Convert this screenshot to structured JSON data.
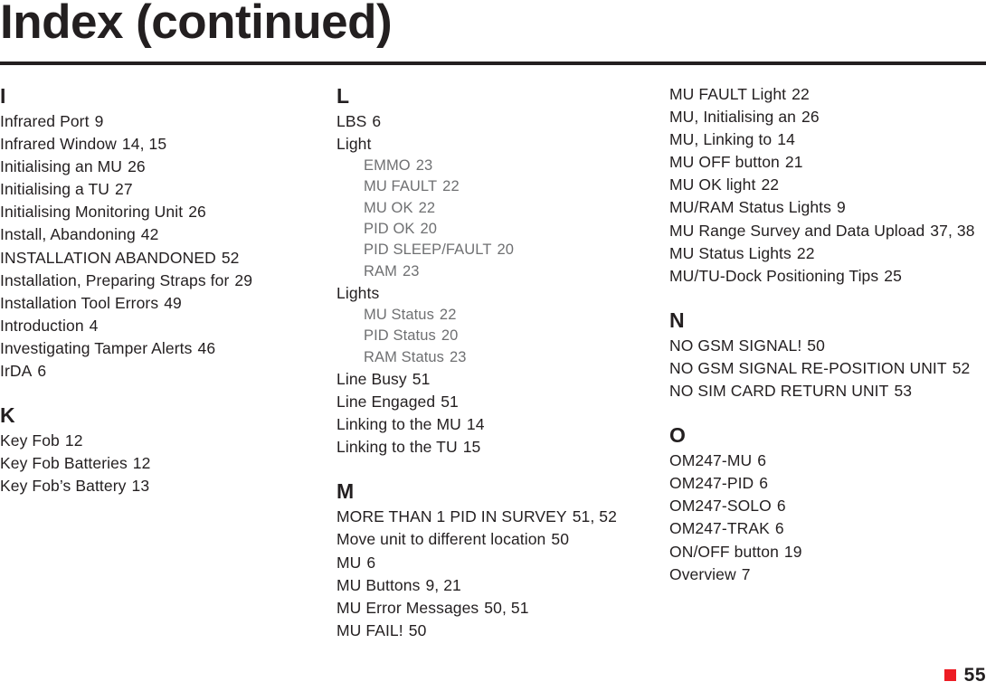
{
  "header": {
    "title": "Index (continued)"
  },
  "footer": {
    "page_number": "55",
    "marker_color": "#ed1c24"
  },
  "colors": {
    "text": "#231f20",
    "subentry_text": "#6f7072",
    "rule": "#231f20",
    "accent": "#ed1c24"
  },
  "columns": [
    {
      "id": "column-1",
      "sections": [
        {
          "letter": "I",
          "entries": [
            {
              "label": "Infrared Port",
              "pages": "9",
              "level": 0
            },
            {
              "label": "Infrared Window",
              "pages": "14, 15",
              "level": 0
            },
            {
              "label": "Initialising an MU",
              "pages": "26",
              "level": 0
            },
            {
              "label": "Initialising a TU",
              "pages": "27",
              "level": 0
            },
            {
              "label": "Initialising Monitoring Unit",
              "pages": "26",
              "level": 0
            },
            {
              "label": "Install, Abandoning",
              "pages": "42",
              "level": 0
            },
            {
              "label": "INSTALLATION ABANDONED",
              "pages": "52",
              "level": 0
            },
            {
              "label": "Installation, Preparing Straps for",
              "pages": "29",
              "level": 0
            },
            {
              "label": "Installation Tool Errors",
              "pages": "49",
              "level": 0
            },
            {
              "label": "Introduction",
              "pages": "4",
              "level": 0
            },
            {
              "label": "Investigating Tamper Alerts",
              "pages": "46",
              "level": 0
            },
            {
              "label": "IrDA",
              "pages": "6",
              "level": 0
            }
          ]
        },
        {
          "letter": "K",
          "entries": [
            {
              "label": "Key Fob",
              "pages": "12",
              "level": 0
            },
            {
              "label": "Key Fob Batteries",
              "pages": "12",
              "level": 0
            },
            {
              "label": "Key Fob’s Battery",
              "pages": "13",
              "level": 0
            }
          ]
        }
      ]
    },
    {
      "id": "column-2",
      "sections": [
        {
          "letter": "L",
          "entries": [
            {
              "label": "LBS",
              "pages": "6",
              "level": 0
            },
            {
              "label": "Light",
              "pages": "",
              "level": 0
            },
            {
              "label": "EMMO",
              "pages": "23",
              "level": 1
            },
            {
              "label": "MU FAULT",
              "pages": "22",
              "level": 1
            },
            {
              "label": "MU OK",
              "pages": "22",
              "level": 1
            },
            {
              "label": "PID OK",
              "pages": "20",
              "level": 1
            },
            {
              "label": "PID SLEEP/FAULT",
              "pages": "20",
              "level": 1
            },
            {
              "label": "RAM",
              "pages": "23",
              "level": 1
            },
            {
              "label": "Lights",
              "pages": "",
              "level": 0
            },
            {
              "label": "MU Status",
              "pages": "22",
              "level": 1
            },
            {
              "label": "PID Status",
              "pages": "20",
              "level": 1
            },
            {
              "label": "RAM Status",
              "pages": "23",
              "level": 1
            },
            {
              "label": "Line Busy",
              "pages": "51",
              "level": 0
            },
            {
              "label": "Line Engaged",
              "pages": "51",
              "level": 0
            },
            {
              "label": "Linking to the MU",
              "pages": "14",
              "level": 0
            },
            {
              "label": "Linking to the TU",
              "pages": "15",
              "level": 0
            }
          ]
        },
        {
          "letter": "M",
          "entries": [
            {
              "label": "MORE THAN 1 PID IN SURVEY",
              "pages": "51, 52",
              "level": 0
            },
            {
              "label": "Move unit to different location",
              "pages": "50",
              "level": 0
            },
            {
              "label": "MU",
              "pages": "6",
              "level": 0
            },
            {
              "label": "MU Buttons",
              "pages": "9, 21",
              "level": 0
            },
            {
              "label": "MU Error Messages",
              "pages": "50, 51",
              "level": 0
            },
            {
              "label": "MU FAIL!",
              "pages": "50",
              "level": 0
            }
          ]
        }
      ]
    },
    {
      "id": "column-3",
      "sections": [
        {
          "letter": "",
          "continuation": true,
          "entries": [
            {
              "label": "MU FAULT Light",
              "pages": "22",
              "level": 0
            },
            {
              "label": "MU, Initialising an",
              "pages": "26",
              "level": 0
            },
            {
              "label": "MU, Linking to",
              "pages": "14",
              "level": 0
            },
            {
              "label": "MU OFF button",
              "pages": "21",
              "level": 0
            },
            {
              "label": "MU OK light",
              "pages": "22",
              "level": 0
            },
            {
              "label": "MU/RAM Status Lights",
              "pages": "9",
              "level": 0
            },
            {
              "label": "MU Range Survey and Data Upload",
              "pages": "37, 38",
              "level": 0
            },
            {
              "label": "MU Status Lights",
              "pages": "22",
              "level": 0
            },
            {
              "label": "MU/TU-Dock Positioning Tips",
              "pages": "25",
              "level": 0
            }
          ]
        },
        {
          "letter": "N",
          "entries": [
            {
              "label": "NO GSM SIGNAL!",
              "pages": "50",
              "level": 0
            },
            {
              "label": "NO GSM SIGNAL RE-POSITION UNIT",
              "pages": "52",
              "level": 0
            },
            {
              "label": "NO SIM CARD RETURN UNIT",
              "pages": "53",
              "level": 0
            }
          ]
        },
        {
          "letter": "O",
          "entries": [
            {
              "label": "OM247-MU",
              "pages": "6",
              "level": 0
            },
            {
              "label": "OM247-PID",
              "pages": "6",
              "level": 0
            },
            {
              "label": "OM247-SOLO",
              "pages": "6",
              "level": 0
            },
            {
              "label": "OM247-TRAK",
              "pages": "6",
              "level": 0
            },
            {
              "label": "ON/OFF button",
              "pages": "19",
              "level": 0
            },
            {
              "label": "Overview",
              "pages": "7",
              "level": 0
            }
          ]
        }
      ]
    }
  ]
}
